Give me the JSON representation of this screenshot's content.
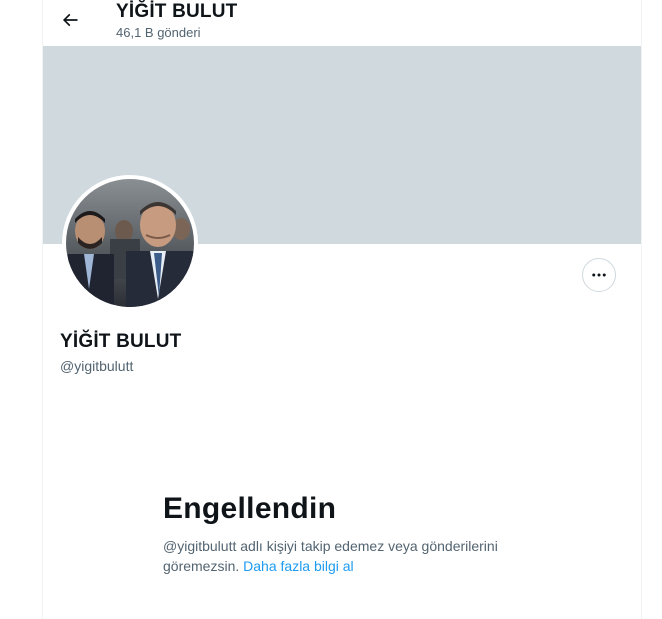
{
  "header": {
    "title": "YİĞİT BULUT",
    "post_count": "46,1 B gönderi",
    "back_icon": "arrow-left-icon"
  },
  "profile": {
    "name": "YİĞİT BULUT",
    "handle": "@yigitbulutt",
    "more_icon": "more-horizontal-icon"
  },
  "blocked": {
    "title": "Engellendin",
    "message": "@yigitbulutt adlı kişiyi takip edemez veya gönderilerini göremezsin.",
    "link": "Daha fazla bilgi al"
  },
  "colors": {
    "banner": "#cfd9de",
    "link": "#1d9bf0",
    "secondary_text": "#536471",
    "primary_text": "#0f1419"
  }
}
